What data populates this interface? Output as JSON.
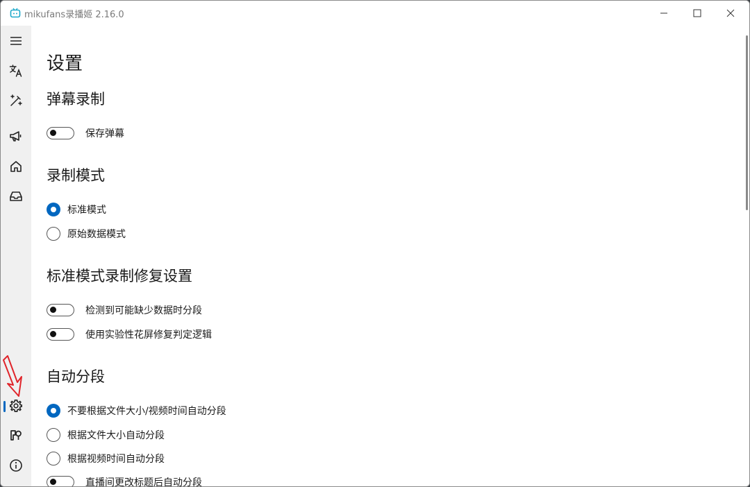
{
  "window": {
    "title": "mikufans录播姬 2.16.0",
    "accent_color": "#0067c0"
  },
  "icons": {
    "app": "tv-icon",
    "minimize": "minimize-icon",
    "maximize": "maximize-icon",
    "close": "close-icon"
  },
  "sidebar": {
    "items": [
      {
        "name": "menu",
        "icon": "hamburger-menu-icon"
      },
      {
        "name": "language",
        "icon": "translate-icon"
      },
      {
        "name": "tools",
        "icon": "magic-wand-icon"
      },
      {
        "name": "announcement",
        "icon": "megaphone-icon"
      },
      {
        "name": "home",
        "icon": "home-icon"
      },
      {
        "name": "rooms",
        "icon": "inbox-icon"
      },
      {
        "name": "settings",
        "icon": "gear-icon",
        "selected": true
      },
      {
        "name": "logs",
        "icon": "log-icon"
      },
      {
        "name": "about",
        "icon": "info-icon"
      }
    ]
  },
  "settings": {
    "page_title": "设置",
    "danmaku": {
      "title": "弹幕录制",
      "save_danmaku": {
        "label": "保存弹幕",
        "on": false
      }
    },
    "record_mode": {
      "title": "录制模式",
      "options": [
        {
          "label": "标准模式",
          "checked": true
        },
        {
          "label": "原始数据模式",
          "checked": false
        }
      ]
    },
    "standard_fix": {
      "title": "标准模式录制修复设置",
      "toggles": [
        {
          "label": "检测到可能缺少数据时分段",
          "on": false
        },
        {
          "label": "使用实验性花屏修复判定逻辑",
          "on": false
        }
      ]
    },
    "auto_split": {
      "title": "自动分段",
      "options": [
        {
          "label": "不要根据文件大小/视频时间自动分段",
          "checked": true
        },
        {
          "label": "根据文件大小自动分段",
          "checked": false
        },
        {
          "label": "根据视频时间自动分段",
          "checked": false
        }
      ],
      "title_change_toggle": {
        "label": "直播间更改标题后自动分段",
        "on": false
      }
    }
  }
}
